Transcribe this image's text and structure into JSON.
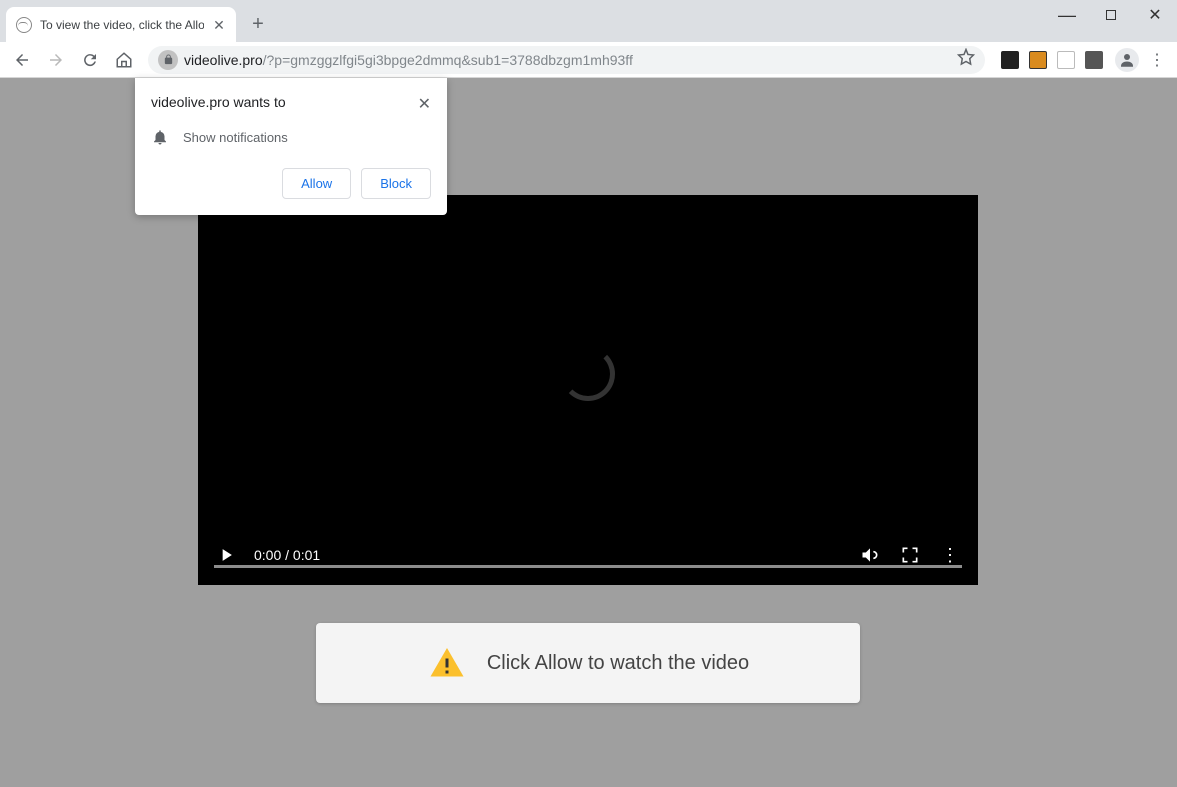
{
  "tab": {
    "title": "To view the video, click the Allow"
  },
  "url": {
    "host": "videolive.pro",
    "path": "/?p=gmzggzlfgi5gi3bpge2dmmq&sub1=3788dbzgm1mh93ff"
  },
  "video": {
    "time": "0:00 / 0:01"
  },
  "banner": {
    "text": "Click Allow to watch the video"
  },
  "permission": {
    "origin_text": "videolive.pro wants to",
    "item": "Show notifications",
    "allow": "Allow",
    "block": "Block"
  }
}
